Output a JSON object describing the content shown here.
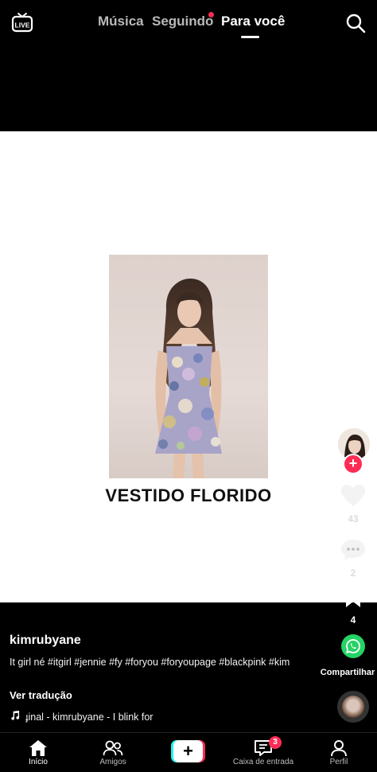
{
  "header": {
    "live_icon": "live-tv-icon",
    "tabs": [
      {
        "label": "Música",
        "active": false
      },
      {
        "label": "Seguindo",
        "active": false,
        "has_dot": true
      },
      {
        "label": "Para você",
        "active": true
      }
    ],
    "search_icon": "search-icon"
  },
  "video": {
    "overlay_text": "VESTIDO FLORIDO"
  },
  "actions": {
    "like_count": "43",
    "comment_count": "2",
    "bookmark_count": "4",
    "share_label": "Compartilhar",
    "follow_symbol": "+",
    "accent_color": "#fe2c55",
    "share_color": "#25d366"
  },
  "post": {
    "username": "kimrubyane",
    "description": "It girl né #itgirl #jennie #fy #foryou #foryoupage #blackpink #kim",
    "translate_label": "Ver tradução",
    "sound": "ɟinal - kimrubyane - I blink for"
  },
  "bottom_nav": {
    "items": [
      {
        "label": "Início",
        "icon": "home-icon",
        "active": true
      },
      {
        "label": "Amigos",
        "icon": "friends-icon",
        "active": false
      },
      {
        "label": "+",
        "icon": "create-icon",
        "active": false
      },
      {
        "label": "Caixa de entrada",
        "icon": "inbox-icon",
        "active": false,
        "badge": "3"
      },
      {
        "label": "Perfil",
        "icon": "profile-icon",
        "active": false
      }
    ]
  }
}
